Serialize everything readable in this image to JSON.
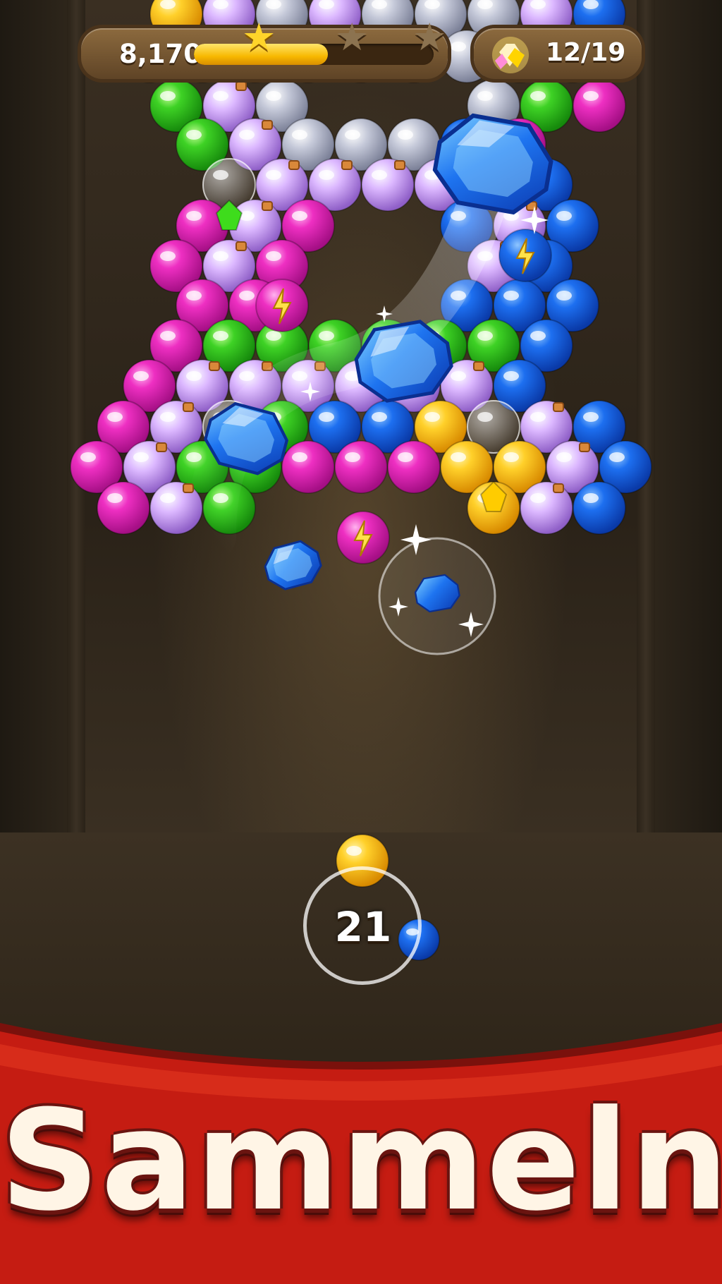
{
  "hud": {
    "score": "8,170",
    "score_progress": 0.56,
    "stars": [
      {
        "name": "star-1",
        "earned": true
      },
      {
        "name": "star-2",
        "earned": false
      },
      {
        "name": "star-3",
        "earned": false
      }
    ],
    "gems_collected": "12/19",
    "gem_icon": "gem-pile-icon"
  },
  "launcher": {
    "shots_remaining": "21",
    "current_bubble_color": "yellow",
    "next_bubble_color": "blue"
  },
  "banner": {
    "title": "Sammeln"
  },
  "colors": {
    "yellow": "#f7b500",
    "blue": "#1762dc",
    "green": "#2fbf1c",
    "pink": "#e020b0",
    "silver": "#aeb3c6",
    "potion": "#c89af0",
    "banner_red": "#c11a12"
  }
}
